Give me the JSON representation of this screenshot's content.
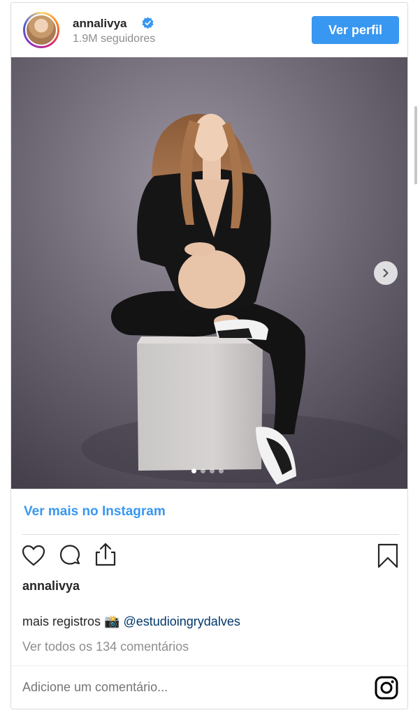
{
  "header": {
    "username": "annalivya",
    "followers": "1.9M seguidores",
    "view_profile_label": "Ver perfil"
  },
  "post": {
    "carousel_total_slides": 4,
    "carousel_active_slide": 1,
    "view_more_label": "Ver mais no Instagram",
    "owner": "annalivya",
    "caption_text": "mais registros 📸",
    "caption_mention": "@estudioingrydalves",
    "view_all_comments": "Ver todos os 134 comentários"
  },
  "comment_box": {
    "placeholder": "Adicione um comentário..."
  },
  "colors": {
    "accent": "#3897f0",
    "verified_badge": "#3897f0",
    "mention": "#00376b",
    "muted": "#8e8e8e"
  },
  "icons": [
    "verified-badge-icon",
    "chevron-right-icon",
    "heart-icon",
    "comment-icon",
    "share-icon",
    "bookmark-icon",
    "instagram-logo-icon"
  ]
}
